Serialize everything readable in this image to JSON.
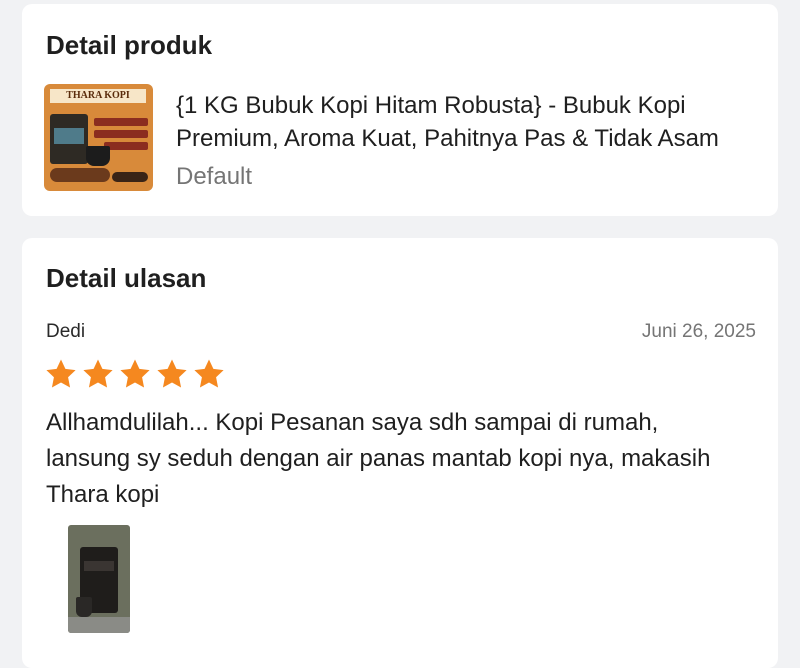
{
  "product_section": {
    "title": "Detail produk",
    "thumbnail_brand": "THARA KOPI",
    "product_name": "{1 KG Bubuk Kopi Hitam Robusta} - Bubuk Kopi Premium, Aroma Kuat, Pahitnya Pas & Tidak Asam",
    "variant": "Default"
  },
  "review_section": {
    "title": "Detail ulasan",
    "reviewer": "Dedi",
    "date": "Juni 26, 2025",
    "rating": 5,
    "rating_max": 5,
    "star_color": "#f5881f",
    "text": "Allhamdulilah... Kopi Pesanan saya sdh sampai di rumah, lansung sy seduh dengan air panas mantab kopi nya, makasih Thara kopi"
  }
}
